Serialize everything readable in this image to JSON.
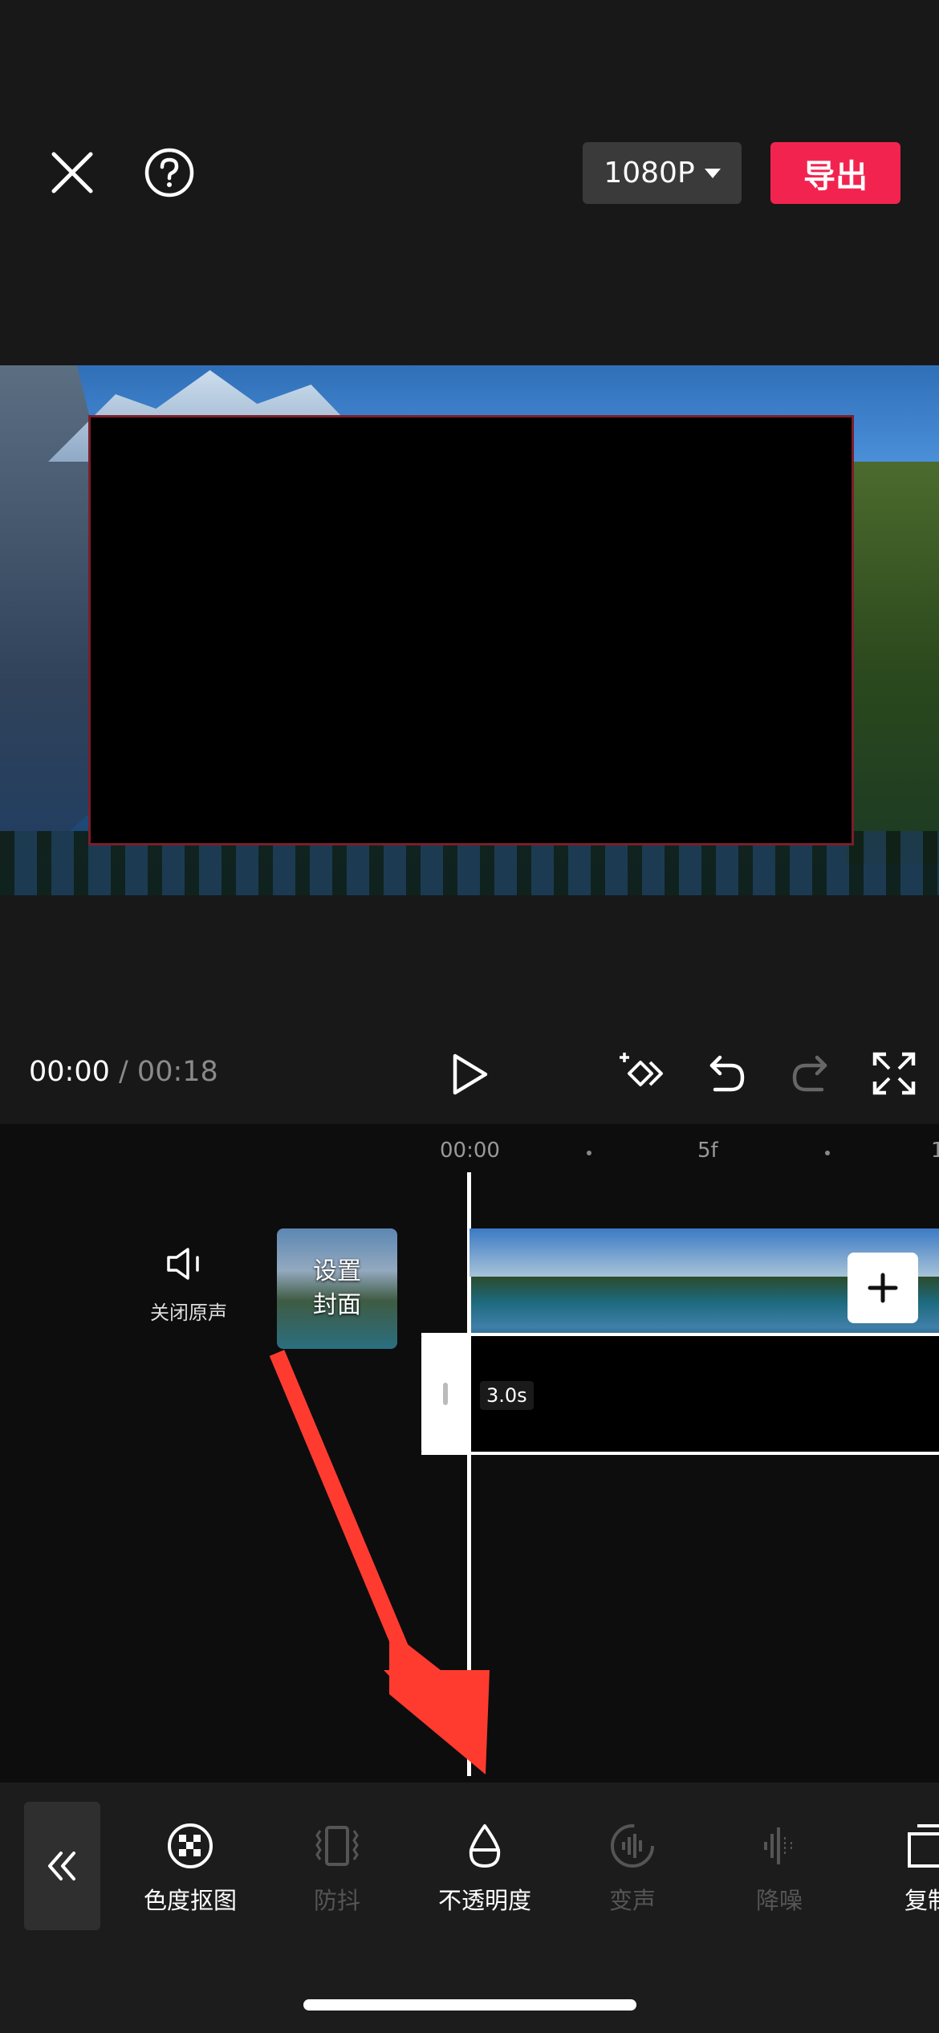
{
  "header": {
    "resolution_label": "1080P",
    "export_label": "导出"
  },
  "playback": {
    "current_time": "00:00",
    "separator": " / ",
    "total_time": "00:18"
  },
  "timeline": {
    "ruler": {
      "start_label": "00:00",
      "mid_label": "5f",
      "end_label": "1"
    },
    "mute_label": "关闭原声",
    "cover_label_line1": "设置",
    "cover_label_line2": "封面",
    "overlay_duration": "3.0s"
  },
  "toolbar": {
    "tools": [
      {
        "label": "色度抠图",
        "icon": "chroma-key-icon",
        "enabled": true
      },
      {
        "label": "防抖",
        "icon": "stabilize-icon",
        "enabled": false
      },
      {
        "label": "不透明度",
        "icon": "opacity-icon",
        "enabled": true
      },
      {
        "label": "变声",
        "icon": "voice-change-icon",
        "enabled": false
      },
      {
        "label": "降噪",
        "icon": "noise-reduction-icon",
        "enabled": false
      },
      {
        "label": "复制",
        "icon": "copy-icon",
        "enabled": true
      }
    ]
  },
  "colors": {
    "export_accent": "#f2244f",
    "annotation_arrow": "#ff3b30"
  }
}
